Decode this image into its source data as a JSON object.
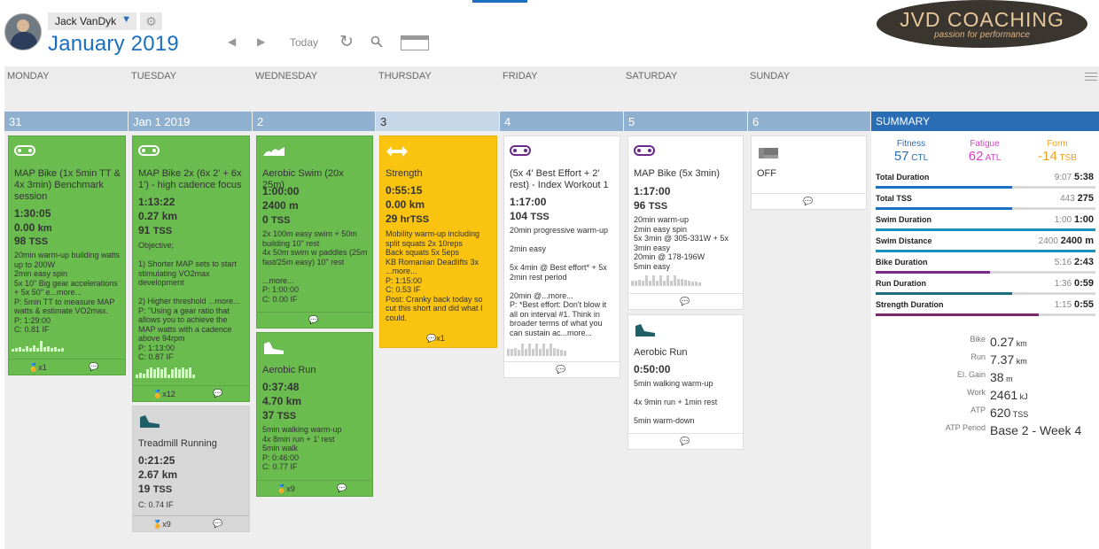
{
  "header": {
    "user": "Jack VanDyk",
    "month": "January",
    "year": "2019",
    "today": "Today",
    "logo_main": "JVD COACHING",
    "logo_tag": "passion for performance"
  },
  "days": [
    "MONDAY",
    "TUESDAY",
    "WEDNESDAY",
    "THURSDAY",
    "FRIDAY",
    "SATURDAY",
    "SUNDAY"
  ],
  "dates": [
    "31",
    "Jan 1 2019",
    "2",
    "3",
    "4",
    "5",
    "6"
  ],
  "workouts": {
    "mon1": {
      "title": "MAP Bike (1x 5min TT & 4x 3min) Benchmark session",
      "time": "1:30:05",
      "dist": "0.00",
      "dist_u": "km",
      "tss": "98",
      "tss_u": "TSS",
      "desc": "20min warm-up building watts up to 200W\n2min easy spin\n5x 10\" Big gear accelerations + 5x 50\" e...more...\nP: 5min TT to measure MAP watts & estimate VO2max.\nP: 1:29:00\nC: 0.81 IF",
      "foot": "x1"
    },
    "tue1": {
      "title": "MAP Bike 2x (6x 2' + 6x 1') - high cadence focus",
      "time": "1:13:22",
      "dist": "0.27 km",
      "tss": "91",
      "tss_u": "TSS",
      "desc": "Objective;\n\n1) Shorter MAP sets to start stimulating VO2max development\n\n2) Higher threshold ...more...\nP: \"Using a gear ratio that allows you to achieve the MAP watts with a cadence above 94rpm\nP: 1:13:00\nC: 0.87 IF",
      "foot": "x12"
    },
    "tue2": {
      "title": "Treadmill Running",
      "time": "0:21:25",
      "dist": "2.67 km",
      "tss": "19",
      "tss_u": "TSS",
      "desc": "C: 0.74 IF",
      "foot": "x9"
    },
    "wed1": {
      "title": "Aerobic Swim (20x 25m)",
      "time": "1:00:00",
      "dist": "2400 m",
      "tss": "0",
      "tss_u": "TSS",
      "desc": "2x 100m easy swim + 50m building 10\" rest\n4x 50m swim w paddles (25m fast/25m easy) 10\" rest\n\n...more...\nP: 1:00:00\nC: 0.00 IF"
    },
    "wed2": {
      "title": "Aerobic Run",
      "time": "0:37:48",
      "dist": "4.70 km",
      "tss": "37",
      "tss_u": "TSS",
      "desc": "5min walking warm-up\n4x 8min run + 1' rest\n5min walk\nP: 0:46:00\nC: 0.77 IF",
      "foot": "x9"
    },
    "thu1": {
      "title": "Strength",
      "time": "0:55:15",
      "dist": "0.00 km",
      "tss": "29",
      "tss_u": "hrTSS",
      "desc": "Mobility warm-up including split squats 2x 10reps\nBack squats 5x 5eps\nKB Romanian Deadlifts 3x ...more...\nP: 1:15:00\nC: 0.53 IF\nPost: Cranky back today so cut this short and did what I could.",
      "foot": "x1"
    },
    "fri1": {
      "title": "(5x 4' Best Effort + 2' rest) - Index Workout 1",
      "time": "1:17:00",
      "tss": "104",
      "tss_u": "TSS",
      "desc": "20min progressive warm-up\n\n2min easy\n\n5x 4min @ Best effort* + 5x 2min rest period\n\n20min @...more...\nP: *Best effort: Don't blow it all on interval #1. Think in broader terms of what you can sustain ac...more..."
    },
    "sat1": {
      "title": "MAP Bike (5x 3min)",
      "time": "1:17:00",
      "tss": "96",
      "tss_u": "TSS",
      "desc": "20min warm-up\n2min easy spin\n5x 3min @ 305-331W + 5x 3min easy\n20min @ 178-196W\n5min easy"
    },
    "sat2": {
      "title": "Aerobic Run",
      "time": "0:50:00",
      "desc": "5min walking warm-up\n\n4x 9min run + 1min rest\n\n5min warm-down"
    },
    "sun1": {
      "title": "OFF"
    }
  },
  "summary": {
    "title": "SUMMARY",
    "fitness": {
      "label": "Fitness",
      "value": "57",
      "unit": "CTL",
      "color": "#2a6db5"
    },
    "fatigue": {
      "label": "Fatigue",
      "value": "62",
      "unit": "ATL",
      "color": "#d63fc7"
    },
    "form": {
      "label": "Form",
      "value": "-14",
      "unit": "TSB",
      "color": "#f0a020"
    },
    "rows": [
      {
        "label": "Total Duration",
        "planned": "9:07",
        "done": "5:38",
        "fill": 0.62,
        "color": "#1a6fc0"
      },
      {
        "label": "Total TSS",
        "planned": "443",
        "done": "275",
        "fill": 0.62,
        "color": "#1a6fc0"
      },
      {
        "label": "Swim Duration",
        "planned": "1:00",
        "done": "1:00",
        "fill": 1.0,
        "color": "#1a8fc0"
      },
      {
        "label": "Swim Distance",
        "planned": "2400",
        "done": "2400 m",
        "fill": 1.0,
        "color": "#1a8fc0"
      },
      {
        "label": "Bike Duration",
        "planned": "5:16",
        "done": "2:43",
        "fill": 0.52,
        "color": "#7a2a8a"
      },
      {
        "label": "Run Duration",
        "planned": "1:36",
        "done": "0:59",
        "fill": 0.62,
        "color": "#1a6f7a"
      },
      {
        "label": "Strength Duration",
        "planned": "1:15",
        "done": "0:55",
        "fill": 0.74,
        "color": "#7a2a6a"
      }
    ],
    "stats": [
      {
        "k": "Bike",
        "v": "0.27",
        "u": "km"
      },
      {
        "k": "Run",
        "v": "7.37",
        "u": "km"
      },
      {
        "k": "El. Gain",
        "v": "38",
        "u": "m"
      },
      {
        "k": "Work",
        "v": "2461",
        "u": "kJ"
      },
      {
        "k": "ATP",
        "v": "620",
        "u": "TSS"
      },
      {
        "k": "ATP Period",
        "v": "Base 2 - Week 4",
        "u": ""
      }
    ]
  }
}
